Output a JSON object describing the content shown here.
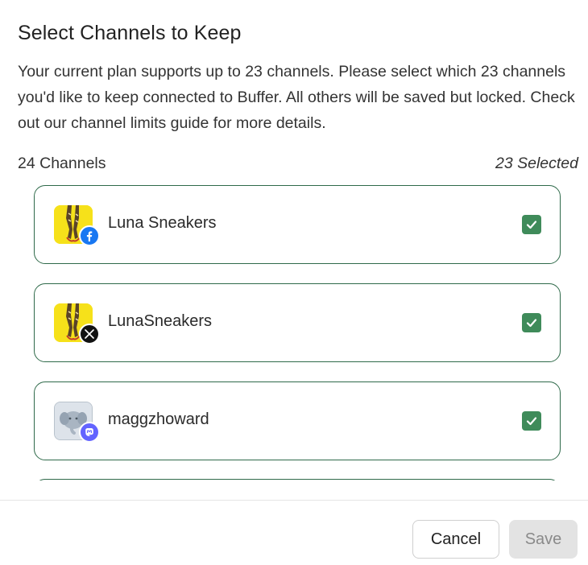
{
  "dialog": {
    "title": "Select Channels to Keep",
    "description": "Your current plan supports up to 23 channels. Please select which 23 channels you'd like to keep connected to Buffer. All others will be saved but locked. Check out our channel limits guide for more details.",
    "channel_count": "24 Channels",
    "selected_count": "23 Selected"
  },
  "channels": [
    {
      "name": "Luna Sneakers",
      "network": "facebook-icon",
      "checked": true
    },
    {
      "name": "LunaSneakers",
      "network": "x-icon",
      "checked": true
    },
    {
      "name": "maggzhoward",
      "network": "mastodon-icon",
      "checked": true
    }
  ],
  "footer": {
    "cancel_label": "Cancel",
    "save_label": "Save"
  },
  "colors": {
    "accent_green": "#3f8b5a",
    "card_border": "#2f6a4a",
    "facebook_blue": "#1877f2",
    "mastodon_purple": "#6364ff"
  }
}
